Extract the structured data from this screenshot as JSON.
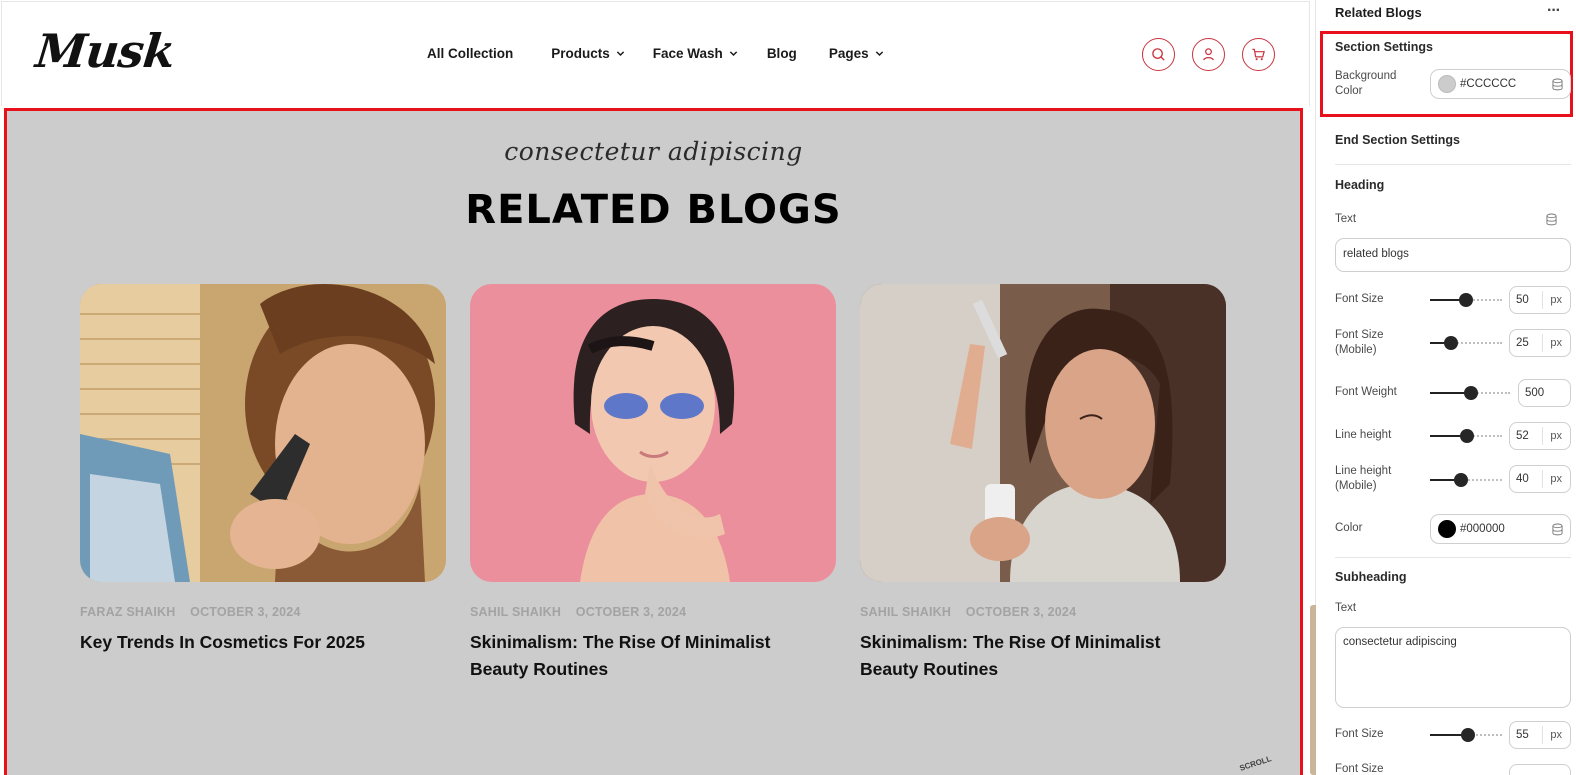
{
  "header": {
    "logo": "Musk",
    "nav": [
      {
        "label": "All Collection",
        "has_dropdown": false
      },
      {
        "label": "Products",
        "has_dropdown": true
      },
      {
        "label": "Face Wash",
        "has_dropdown": true
      },
      {
        "label": "Blog",
        "has_dropdown": false
      },
      {
        "label": "Pages",
        "has_dropdown": true
      }
    ],
    "icons": [
      "search-icon",
      "user-icon",
      "cart-icon"
    ],
    "accent_color": "#C9343F"
  },
  "section": {
    "subheading": "consectetur adipiscing",
    "heading": "RELATED BLOGS",
    "background_color": "#CCCCCC",
    "cards": [
      {
        "author": "FARAZ SHAIKH",
        "date": "OCTOBER 3, 2024",
        "title": "Key Trends In Cosmetics For 2025"
      },
      {
        "author": "SAHIL SHAIKH",
        "date": "OCTOBER 3, 2024",
        "title": "Skinimalism: The Rise Of Minimalist Beauty Routines"
      },
      {
        "author": "SAHIL SHAIKH",
        "date": "OCTOBER 3, 2024",
        "title": "Skinimalism: The Rise Of Minimalist Beauty Routines"
      }
    ],
    "scroll_badge": "SCROLL"
  },
  "panel": {
    "title": "Related Blogs",
    "more_icon": "more-dots-icon",
    "section_settings": {
      "title": "Section Settings",
      "bg_label": "Background Color",
      "bg_value": "#CCCCCC"
    },
    "end_section_settings": "End Section Settings",
    "heading": {
      "title": "Heading",
      "text_label": "Text",
      "text_value": "related blogs",
      "font_size_label": "Font Size",
      "font_size_value": "50",
      "font_size_mobile_label": "Font Size (Mobile)",
      "font_size_mobile_value": "25",
      "font_weight_label": "Font Weight",
      "font_weight_value": "500",
      "line_height_label": "Line height",
      "line_height_value": "52",
      "line_height_mobile_label": "Line height (Mobile)",
      "line_height_mobile_value": "40",
      "color_label": "Color",
      "color_value": "#000000",
      "unit": "px"
    },
    "subheading": {
      "title": "Subheading",
      "text_label": "Text",
      "text_value": "consectetur adipiscing",
      "font_size_label": "Font Size",
      "font_size_value": "55",
      "font_size_mobile_label": "Font Size",
      "unit": "px"
    }
  }
}
